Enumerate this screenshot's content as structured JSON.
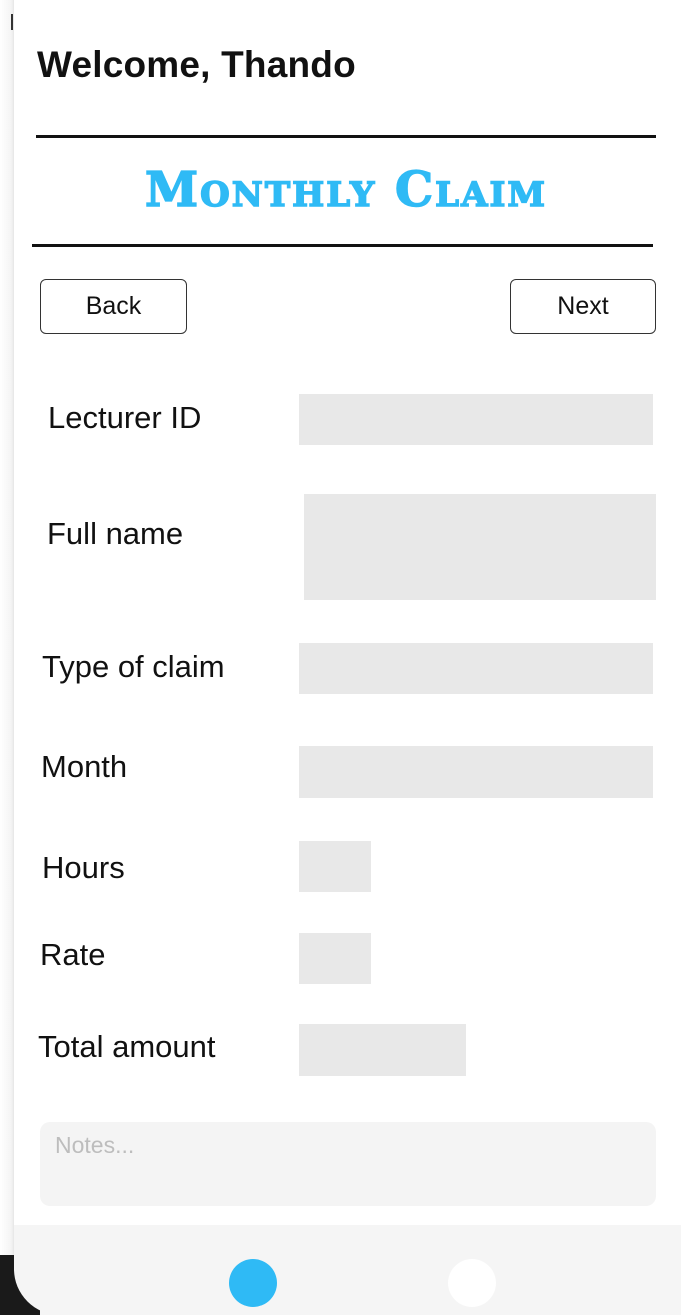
{
  "header": {
    "welcome": "Welcome, Thando",
    "title": "Monthly Claim"
  },
  "nav": {
    "back_label": "Back",
    "next_label": "Next"
  },
  "form": {
    "lecturer_id": {
      "label": "Lecturer ID",
      "value": ""
    },
    "full_name": {
      "label": "Full name",
      "value": ""
    },
    "type_of_claim": {
      "label": "Type of claim",
      "value": ""
    },
    "month": {
      "label": "Month",
      "value": ""
    },
    "hours": {
      "label": "Hours",
      "value": ""
    },
    "rate": {
      "label": "Rate",
      "value": ""
    },
    "total_amount": {
      "label": "Total amount",
      "value": ""
    },
    "notes": {
      "placeholder": "Notes..."
    }
  },
  "bottom_nav": {
    "active_index": 0,
    "dots": [
      "page-1",
      "page-2"
    ],
    "accent_color": "#2fbaf5"
  }
}
